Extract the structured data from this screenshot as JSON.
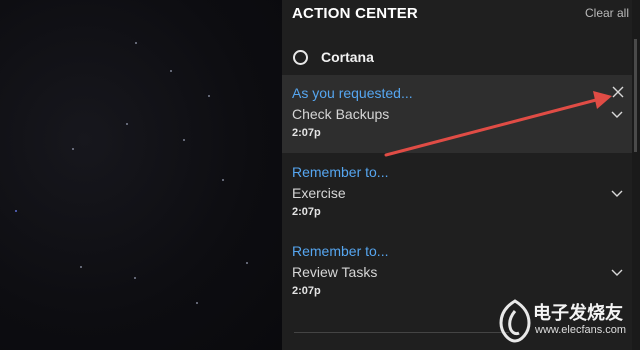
{
  "action_center": {
    "title": "ACTION CENTER",
    "clear_all": "Clear all",
    "group": {
      "label": "Cortana",
      "icon": "cortana-circle-icon"
    },
    "notifications": [
      {
        "title": "As you requested...",
        "body": "Check Backups",
        "time": "2:07p",
        "selected": true
      },
      {
        "title": "Remember to...",
        "body": "Exercise",
        "time": "2:07p",
        "selected": false
      },
      {
        "title": "Remember to...",
        "body": "Review Tasks",
        "time": "2:07p",
        "selected": false
      }
    ]
  },
  "annotation": {
    "type": "arrow",
    "color": "#e04c45",
    "points_to": "dismiss-notification-button"
  },
  "watermark": {
    "chinese": "电子发烧友",
    "url": "www.elecfans.com"
  },
  "colors": {
    "panel": "#1f1f1f",
    "selected": "#2e2e2e",
    "accent": "#56a6f0",
    "arrow": "#e04c45"
  }
}
